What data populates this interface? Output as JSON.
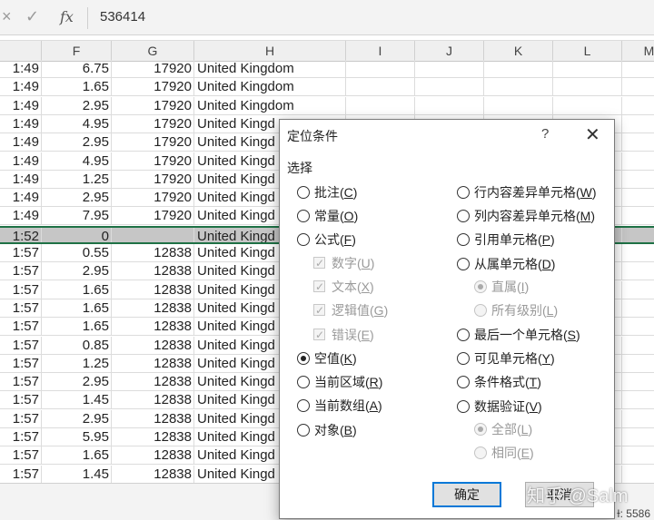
{
  "formula_bar": {
    "cancel_icon": "×",
    "enter_icon": "✓",
    "fx": "fx",
    "value": "536414"
  },
  "columns": [
    "F",
    "G",
    "H",
    "I",
    "J",
    "K",
    "L",
    "M"
  ],
  "rows": [
    {
      "e": "1:49",
      "f": "6.75",
      "g": "17920",
      "h": "United Kingdom"
    },
    {
      "e": "1:49",
      "f": "1.65",
      "g": "17920",
      "h": "United Kingdom"
    },
    {
      "e": "1:49",
      "f": "2.95",
      "g": "17920",
      "h": "United Kingdom"
    },
    {
      "e": "1:49",
      "f": "4.95",
      "g": "17920",
      "h": "United Kingd"
    },
    {
      "e": "1:49",
      "f": "2.95",
      "g": "17920",
      "h": "United Kingd"
    },
    {
      "e": "1:49",
      "f": "4.95",
      "g": "17920",
      "h": "United Kingd"
    },
    {
      "e": "1:49",
      "f": "1.25",
      "g": "17920",
      "h": "United Kingd"
    },
    {
      "e": "1:49",
      "f": "2.95",
      "g": "17920",
      "h": "United Kingd"
    },
    {
      "e": "1:49",
      "f": "7.95",
      "g": "17920",
      "h": "United Kingd"
    },
    {
      "e": "1:52",
      "f": "0",
      "g": "",
      "h": "United Kingd",
      "selected": true
    },
    {
      "e": "1:57",
      "f": "0.55",
      "g": "12838",
      "h": "United Kingd"
    },
    {
      "e": "1:57",
      "f": "2.95",
      "g": "12838",
      "h": "United Kingd"
    },
    {
      "e": "1:57",
      "f": "1.65",
      "g": "12838",
      "h": "United Kingd"
    },
    {
      "e": "1:57",
      "f": "1.65",
      "g": "12838",
      "h": "United Kingd"
    },
    {
      "e": "1:57",
      "f": "1.65",
      "g": "12838",
      "h": "United Kingd"
    },
    {
      "e": "1:57",
      "f": "0.85",
      "g": "12838",
      "h": "United Kingd"
    },
    {
      "e": "1:57",
      "f": "1.25",
      "g": "12838",
      "h": "United Kingd"
    },
    {
      "e": "1:57",
      "f": "2.95",
      "g": "12838",
      "h": "United Kingd"
    },
    {
      "e": "1:57",
      "f": "1.45",
      "g": "12838",
      "h": "United Kingd"
    },
    {
      "e": "1:57",
      "f": "2.95",
      "g": "12838",
      "h": "United Kingd"
    },
    {
      "e": "1:57",
      "f": "5.95",
      "g": "12838",
      "h": "United Kingd"
    },
    {
      "e": "1:57",
      "f": "1.65",
      "g": "12838",
      "h": "United Kingd"
    },
    {
      "e": "1:57",
      "f": "1.45",
      "g": "12838",
      "h": "United Kingd"
    }
  ],
  "status_text": "Ɨ: 5586",
  "dialog": {
    "title": "定位条件",
    "help": "?",
    "close": "✕",
    "group_label": "选择",
    "left_options": [
      {
        "text": "批注(",
        "key": "C",
        "end": ")"
      },
      {
        "text": "常量(",
        "key": "O",
        "end": ")"
      },
      {
        "text": "公式(",
        "key": "F",
        "end": ")"
      }
    ],
    "formula_checks": [
      {
        "text": "数字(",
        "key": "U",
        "end": ")"
      },
      {
        "text": "文本(",
        "key": "X",
        "end": ")"
      },
      {
        "text": "逻辑值(",
        "key": "G",
        "end": ")"
      },
      {
        "text": "错误(",
        "key": "E",
        "end": ")"
      }
    ],
    "left_options2": [
      {
        "text": "空值(",
        "key": "K",
        "end": ")",
        "checked": true
      },
      {
        "text": "当前区域(",
        "key": "R",
        "end": ")"
      },
      {
        "text": "当前数组(",
        "key": "A",
        "end": ")"
      },
      {
        "text": "对象(",
        "key": "B",
        "end": ")"
      }
    ],
    "right_options": [
      {
        "text": "行内容差异单元格(",
        "key": "W",
        "end": ")"
      },
      {
        "text": "列内容差异单元格(",
        "key": "M",
        "end": ")"
      },
      {
        "text": "引用单元格(",
        "key": "P",
        "end": ")"
      },
      {
        "text": "从属单元格(",
        "key": "D",
        "end": ")"
      }
    ],
    "dep_sub": [
      {
        "text": "直属(",
        "key": "I",
        "end": ")",
        "checked": true
      },
      {
        "text": "所有级别(",
        "key": "L",
        "end": ")"
      }
    ],
    "right_options2": [
      {
        "text": "最后一个单元格(",
        "key": "S",
        "end": ")"
      },
      {
        "text": "可见单元格(",
        "key": "Y",
        "end": ")"
      },
      {
        "text": "条件格式(",
        "key": "T",
        "end": ")"
      },
      {
        "text": "数据验证(",
        "key": "V",
        "end": ")"
      }
    ],
    "val_sub": [
      {
        "text": "全部(",
        "key": "L",
        "end": ")",
        "checked": true
      },
      {
        "text": "相同(",
        "key": "E",
        "end": ")"
      }
    ],
    "ok": "确定",
    "cancel": "取消"
  },
  "watermark": "知乎 @Salm"
}
